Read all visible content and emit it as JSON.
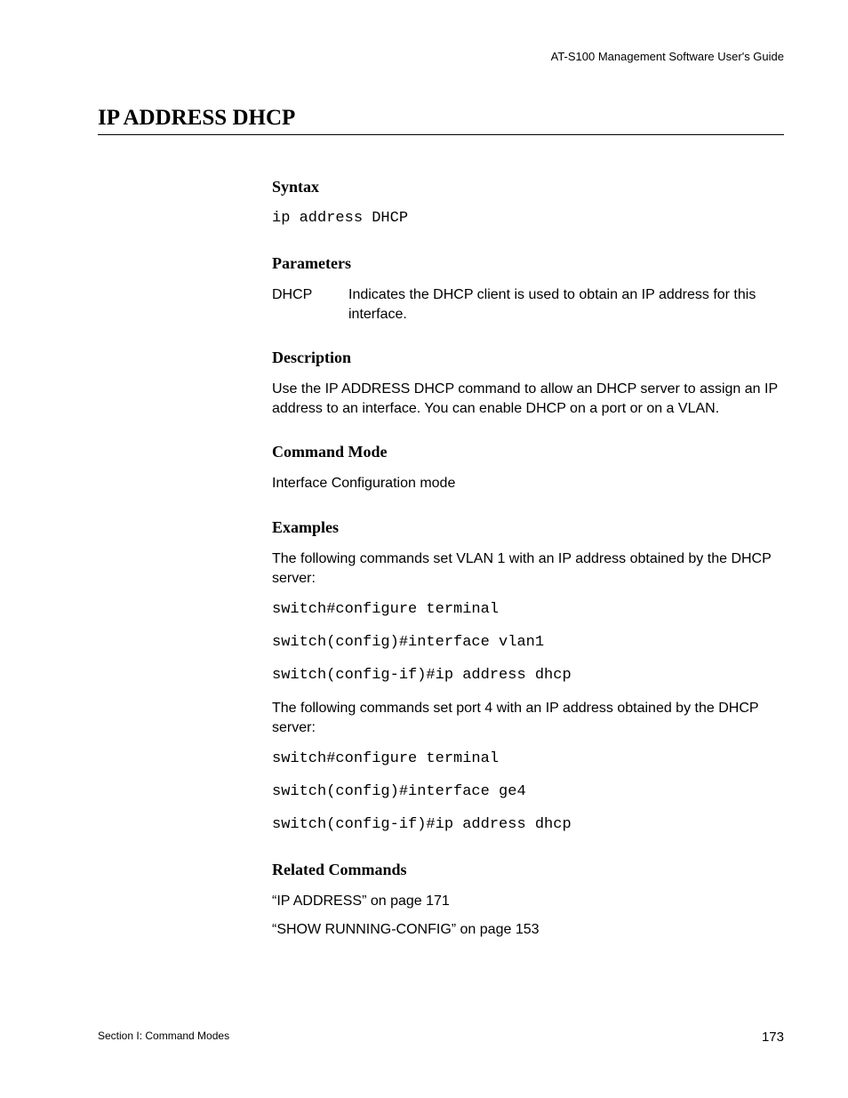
{
  "header": {
    "running_title": "AT-S100 Management Software User's Guide"
  },
  "title": "IP ADDRESS DHCP",
  "syntax": {
    "heading": "Syntax",
    "code": "ip address DHCP"
  },
  "parameters": {
    "heading": "Parameters",
    "rows": [
      {
        "term": "DHCP",
        "def": "Indicates the DHCP client is used to obtain an IP address for this interface."
      }
    ]
  },
  "description": {
    "heading": "Description",
    "text": "Use the IP ADDRESS DHCP command to allow an DHCP server to assign an IP address to an interface. You can enable DHCP on a port or on a VLAN."
  },
  "command_mode": {
    "heading": "Command Mode",
    "text": "Interface Configuration mode"
  },
  "examples": {
    "heading": "Examples",
    "intro1": "The following commands set VLAN 1 with an IP address obtained by the DHCP server:",
    "code1a": "switch#configure terminal",
    "code1b": "switch(config)#interface vlan1",
    "code1c": "switch(config-if)#ip address dhcp",
    "intro2": "The following commands set port 4 with an IP address obtained by the DHCP server:",
    "code2a": "switch#configure terminal",
    "code2b": "switch(config)#interface ge4",
    "code2c": "switch(config-if)#ip address dhcp"
  },
  "related": {
    "heading": "Related Commands",
    "items": [
      "“IP ADDRESS” on page 171",
      "“SHOW RUNNING-CONFIG” on page 153"
    ]
  },
  "footer": {
    "left": "Section I: Command Modes",
    "right": "173"
  }
}
